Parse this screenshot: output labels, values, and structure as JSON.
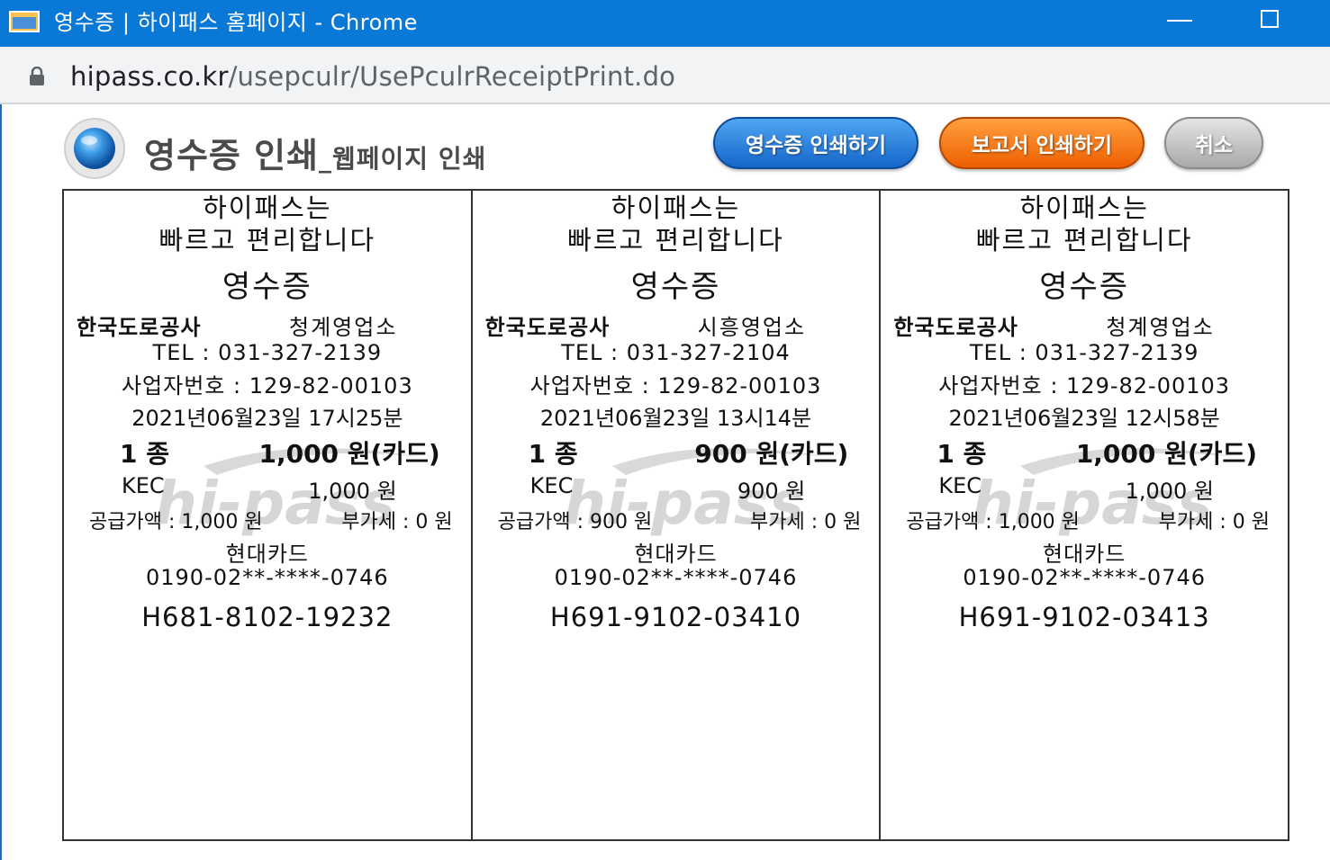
{
  "browser": {
    "window_title": "영수증 | 하이패스 홈페이지 - Chrome",
    "url_host": "hipass.co.kr",
    "url_path": "/usepculr/UsePculrReceiptPrint.do"
  },
  "header": {
    "title": "영수증 인쇄",
    "subtitle": "_웹페이지 인쇄",
    "print_receipt_label": "영수증 인쇄하기",
    "print_report_label": "보고서 인쇄하기",
    "cancel_label": "취소"
  },
  "receipts": [
    {
      "slogan_line1": "하이패스는",
      "slogan_line2": "빠르고 편리합니다",
      "title": "영수증",
      "company": "한국도로공사",
      "office": "청계영업소",
      "tel": "TEL : 031-327-2139",
      "biz_no": "사업자번호 : 129-82-00103",
      "datetime": "2021년06월23일 17시25분",
      "vehicle_class": "1 종",
      "amount": "1,000 원(카드)",
      "kec_label": "KEC",
      "kec_amount": "1,000 원",
      "supply_price": "공급가액 : 1,000 원",
      "vat": "부가세 : 0 원",
      "card_company": "현대카드",
      "card_number": "0190-02**-****-0746",
      "receipt_number": "H681-8102-19232"
    },
    {
      "slogan_line1": "하이패스는",
      "slogan_line2": "빠르고 편리합니다",
      "title": "영수증",
      "company": "한국도로공사",
      "office": "시흥영업소",
      "tel": "TEL : 031-327-2104",
      "biz_no": "사업자번호 : 129-82-00103",
      "datetime": "2021년06월23일 13시14분",
      "vehicle_class": "1 종",
      "amount": "900 원(카드)",
      "kec_label": "KEC",
      "kec_amount": "900 원",
      "supply_price": "공급가액 : 900 원",
      "vat": "부가세 : 0 원",
      "card_company": "현대카드",
      "card_number": "0190-02**-****-0746",
      "receipt_number": "H691-9102-03410"
    },
    {
      "slogan_line1": "하이패스는",
      "slogan_line2": "빠르고 편리합니다",
      "title": "영수증",
      "company": "한국도로공사",
      "office": "청계영업소",
      "tel": "TEL : 031-327-2139",
      "biz_no": "사업자번호 : 129-82-00103",
      "datetime": "2021년06월23일 12시58분",
      "vehicle_class": "1 종",
      "amount": "1,000 원(카드)",
      "kec_label": "KEC",
      "kec_amount": "1,000 원",
      "supply_price": "공급가액 : 1,000 원",
      "vat": "부가세 : 0 원",
      "card_company": "현대카드",
      "card_number": "0190-02**-****-0746",
      "receipt_number": "H691-9102-03413"
    }
  ],
  "watermark": "hi-pass",
  "colors": {
    "titlebar": "#0a78d7",
    "print_button": "#1e76d8",
    "report_button": "#f57a1a",
    "cancel_button": "#c4c4c4"
  }
}
